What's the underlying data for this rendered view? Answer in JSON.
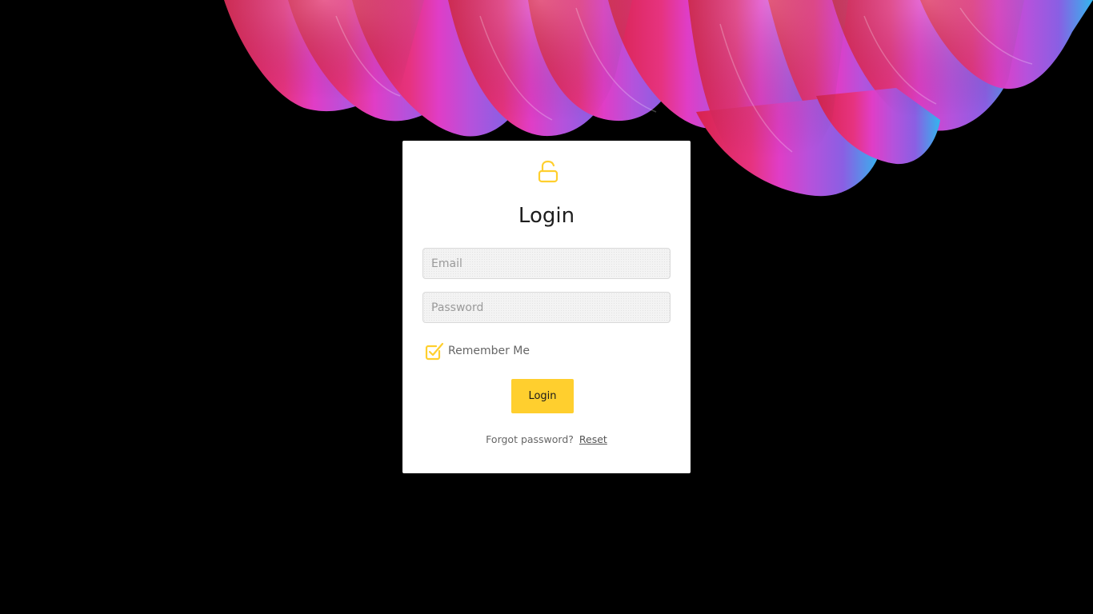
{
  "background": {
    "image": "colorful-dahlia-petals",
    "colors": [
      "#e8336a",
      "#e63fc0",
      "#9b5be0",
      "#3fb2e6"
    ]
  },
  "login_card": {
    "icon": "unlock-icon",
    "title": "Login",
    "email": {
      "placeholder": "Email",
      "value": ""
    },
    "password": {
      "placeholder": "Password",
      "value": ""
    },
    "remember": {
      "label": "Remember Me",
      "checked": true,
      "icon": "checkbox-checked-icon"
    },
    "submit_label": "Login",
    "forgot_text": "Forgot password?",
    "reset_link": "Reset",
    "accent_color": "#ffcf2e"
  }
}
